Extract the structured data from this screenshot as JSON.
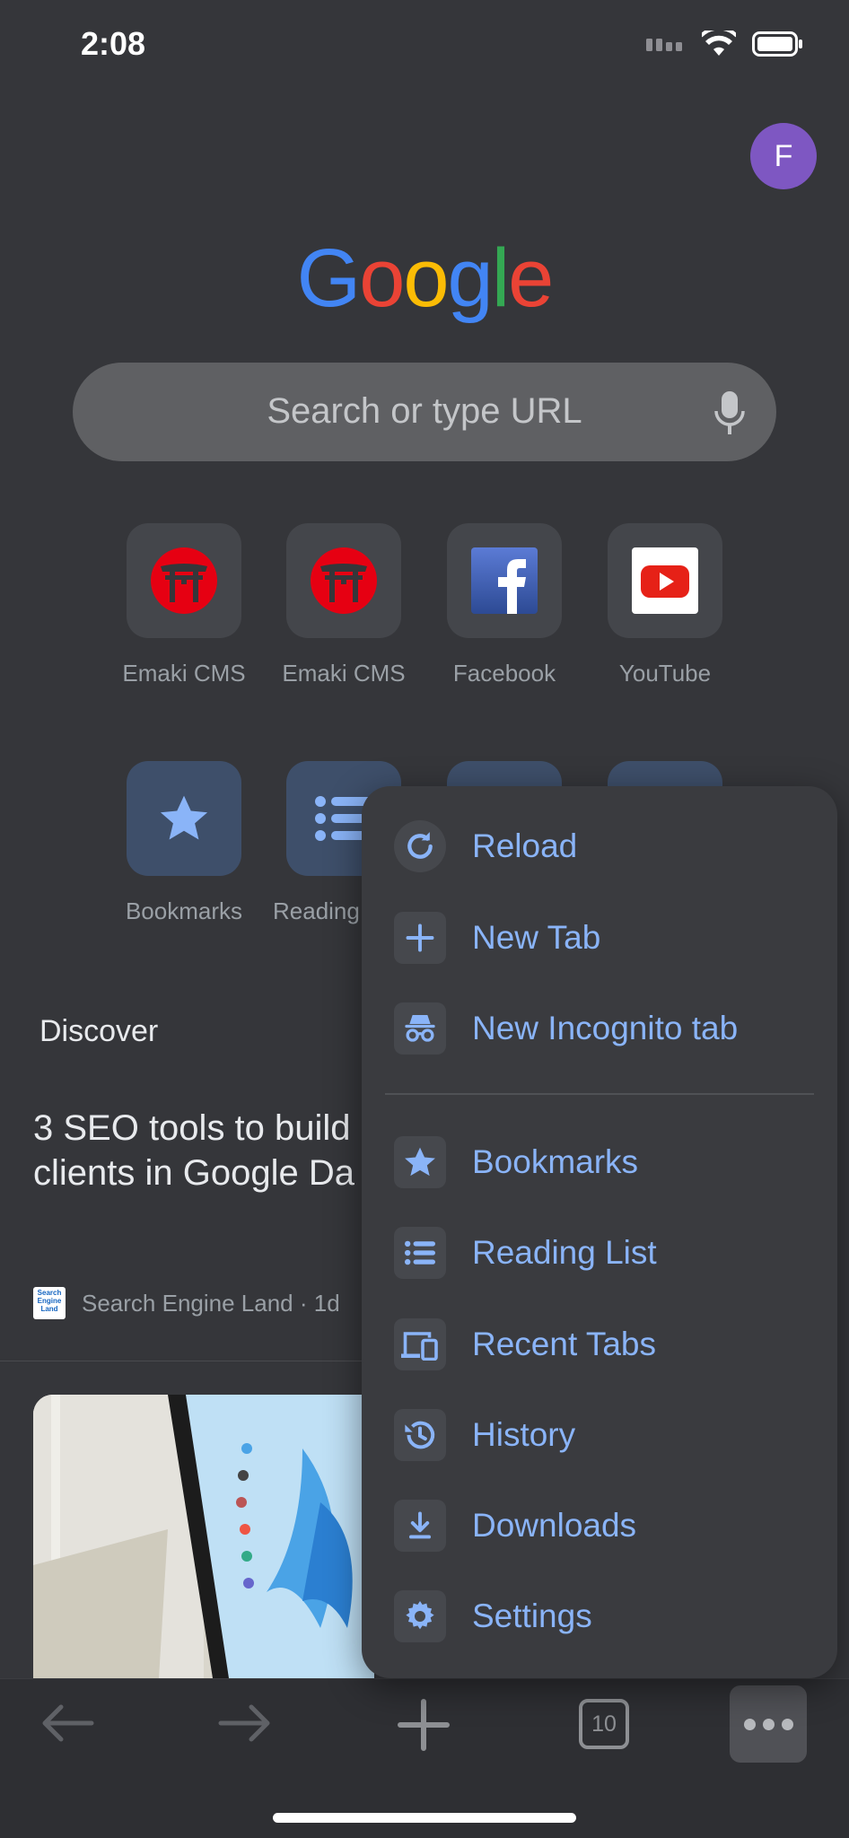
{
  "status_bar": {
    "time": "2:08",
    "icons": [
      "signal-icon",
      "wifi-icon",
      "battery-icon"
    ]
  },
  "profile": {
    "initial": "F",
    "color": "#7e57c2"
  },
  "logo": {
    "letters": [
      "G",
      "o",
      "o",
      "g",
      "l",
      "e"
    ],
    "colors": [
      "#4285f4",
      "#ea4335",
      "#fbbc05",
      "#4285f4",
      "#34a853",
      "#ea4335"
    ]
  },
  "search": {
    "placeholder": "Search or type URL"
  },
  "shortcuts": [
    {
      "label": "Emaki CMS",
      "icon": "torii-gate-icon"
    },
    {
      "label": "Emaki CMS",
      "icon": "torii-gate-icon"
    },
    {
      "label": "Facebook",
      "icon": "facebook-icon"
    },
    {
      "label": "YouTube",
      "icon": "youtube-icon"
    }
  ],
  "quick_actions": [
    {
      "label": "Bookmarks",
      "icon": "star-icon"
    },
    {
      "label": "Reading",
      "icon": "list-icon"
    }
  ],
  "discover": {
    "title": "Discover",
    "article": {
      "headline": "3 SEO tools to build clients in Google Da",
      "source": "Search Engine Land · 1d",
      "source_logo_text": "Search Engine Land"
    }
  },
  "menu": {
    "items": [
      {
        "label": "Reload",
        "icon": "reload-icon"
      },
      {
        "label": "New Tab",
        "icon": "plus-icon"
      },
      {
        "label": "New Incognito tab",
        "icon": "incognito-icon"
      },
      {
        "label": "Bookmarks",
        "icon": "star-icon"
      },
      {
        "label": "Reading List",
        "icon": "list-icon"
      },
      {
        "label": "Recent Tabs",
        "icon": "devices-icon"
      },
      {
        "label": "History",
        "icon": "history-icon"
      },
      {
        "label": "Downloads",
        "icon": "download-icon"
      },
      {
        "label": "Settings",
        "icon": "gear-icon"
      }
    ],
    "accent": "#8ab4f8"
  },
  "toolbar": {
    "tab_count": "10"
  }
}
